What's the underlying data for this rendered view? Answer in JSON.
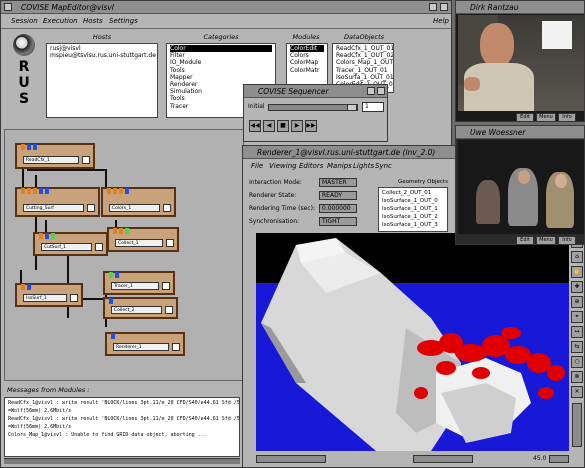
{
  "main_window": {
    "title": "COVISE MapEditor@visvl",
    "menu": [
      "Session",
      "Execution",
      "Hosts",
      "Settings"
    ],
    "help": "Help",
    "logo_letters": [
      "R",
      "U",
      "S"
    ],
    "hosts_label": "Hosts",
    "hosts": [
      "rusj@visvl",
      "mspieu@tsvlsu.rus.uni-stuttgart.de"
    ],
    "categories_label": "Categories",
    "categories": [
      "Color",
      "Filter",
      "IO_Module",
      "Tools",
      "Mapper",
      "Renderer",
      "Simulation",
      "Tools",
      "Tracer"
    ],
    "modules_label": "Modules",
    "modules": [
      "ColorEdit",
      "Colors",
      "ColorMap",
      "ColorMatr"
    ],
    "dataobjects_label": "DataObjects",
    "dataobjects": [
      "ReadCfx_1_OUT_01",
      "ReadCfx_1_OUT_02",
      "Colors_Map_1_OUT_02",
      "Tracer_1_OUT_01",
      "IsoSurfa_1_OUT_01",
      "ColorEdit_1_OUT_02"
    ],
    "messages_label": "Messages from Modules :",
    "messages": [
      "ReadCfx_1@visvl : write result 'BLOCK/lines 3pt.11/e_20 CFD/S40/e44.61 Sfd /5m 1.1/m]",
      "=Wolf(56mm) 2.6Mbit/s",
      "ReadCfx_1@visvl : write result 'BLOCK/lines 3pt.11/e_20 CFD/S40/e44.61 Sfd /5m 1.1/m]",
      "=Wolf(56mm) 2.6Mbit/s",
      "Colors_Map_1@visvl : Unable to find GRID data object, aborting ..."
    ]
  },
  "modules": [
    "ReadCfx_1",
    "Cutting_Surf",
    "Colors_1",
    "CutSurf_1",
    "Collect_1",
    "Tracer_1",
    "IsoSurf_1",
    "Collect_2",
    "Renderer_1"
  ],
  "sequencer": {
    "title": "COVISE Sequencer",
    "label": "Initial",
    "value": "1",
    "buttons": [
      "◀◀",
      "◀",
      "■",
      "▶",
      "▶▶"
    ]
  },
  "renderer": {
    "title": "Renderer_1@visvl.rus.uni-stuttgart.de (inv_2.0)",
    "menu": [
      "File",
      "Viewing",
      "Editors",
      "Manips",
      "Lights",
      "Sync"
    ],
    "status": [
      {
        "label": "Interaction Mode:",
        "value": "MASTER"
      },
      {
        "label": "Renderer State:",
        "value": "READY"
      },
      {
        "label": "Rendering Time (sec):",
        "value": "0.000000"
      },
      {
        "label": "Synchronisation:",
        "value": "TIGHT"
      }
    ],
    "objects_label": "Geometry Objects",
    "objects": [
      "Collect_2_OUT_01",
      "IsoSurface_1_OUT_0",
      "IsoSurface_1_OUT_1",
      "IsoSurface_1_OUT_2",
      "IsoSurface_1_OUT_3"
    ],
    "side_tools": [
      "?",
      "⌂",
      "✋",
      "✚",
      "⊕",
      "⌖",
      "↔",
      "⇆",
      "○",
      "⊗",
      "✕"
    ],
    "zoom_value": "45.0"
  },
  "video_top": {
    "title": "Dirk Rantzau",
    "buttons": [
      "Edit",
      "Menu",
      "Info"
    ]
  },
  "video_bottom": {
    "title": "Uwe Woessner",
    "buttons": [
      "Edit",
      "Menu",
      "Info"
    ]
  }
}
